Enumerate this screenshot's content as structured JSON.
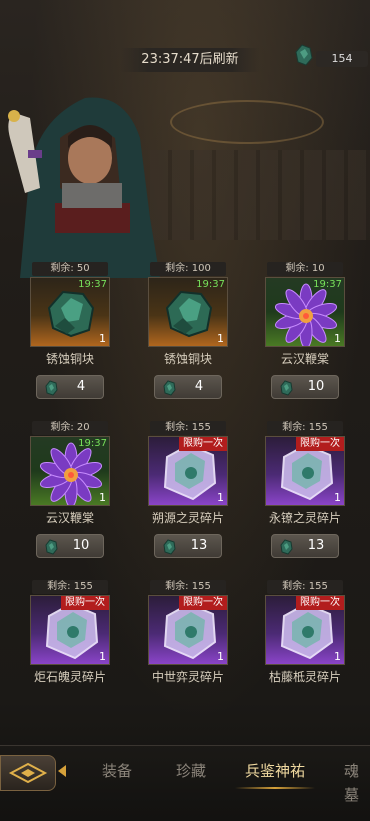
{
  "header": {
    "refresh_timer": "23:37:47后刷新",
    "currency_amount": "154",
    "currency_icon": "bronze-ore-icon"
  },
  "items": [
    {
      "stock": "剩余: 50",
      "timer": "19:37",
      "qty": "1",
      "limit": "",
      "name": "锈蚀铜块",
      "price": "4",
      "art": "bronze-ore-icon",
      "rarity": "orange"
    },
    {
      "stock": "剩余: 100",
      "timer": "19:37",
      "qty": "1",
      "limit": "",
      "name": "锈蚀铜块",
      "price": "4",
      "art": "bronze-ore-icon",
      "rarity": "orange"
    },
    {
      "stock": "剩余: 10",
      "timer": "19:37",
      "qty": "1",
      "limit": "",
      "name": "云汉鞭棠",
      "price": "10",
      "art": "purple-flower-icon",
      "rarity": "green"
    },
    {
      "stock": "剩余: 20",
      "timer": "19:37",
      "qty": "1",
      "limit": "",
      "name": "云汉鞭棠",
      "price": "10",
      "art": "purple-flower-icon",
      "rarity": "green"
    },
    {
      "stock": "剩余: 155",
      "timer": "",
      "qty": "1",
      "limit": "限购一次",
      "name": "朔源之灵碎片",
      "price": "13",
      "art": "spirit-crystal-icon",
      "rarity": "purple"
    },
    {
      "stock": "剩余: 155",
      "timer": "",
      "qty": "1",
      "limit": "限购一次",
      "name": "永镣之灵碎片",
      "price": "13",
      "art": "spirit-crystal-icon",
      "rarity": "purple"
    },
    {
      "stock": "剩余: 155",
      "timer": "",
      "qty": "1",
      "limit": "限购一次",
      "name": "炬石魄灵碎片",
      "price": "",
      "art": "spirit-crystal-icon",
      "rarity": "purple"
    },
    {
      "stock": "剩余: 155",
      "timer": "",
      "qty": "1",
      "limit": "限购一次",
      "name": "中世弈灵碎片",
      "price": "",
      "art": "spirit-crystal-icon",
      "rarity": "purple"
    },
    {
      "stock": "剩余: 155",
      "timer": "",
      "qty": "1",
      "limit": "限购一次",
      "name": "枯藤柢灵碎片",
      "price": "",
      "art": "spirit-crystal-icon",
      "rarity": "purple"
    }
  ],
  "nav": {
    "tabs": [
      "装备",
      "珍藏",
      "兵鉴神祐",
      "魂墓"
    ],
    "active_tab": "兵鉴神祐",
    "back_icon": "diamond-arrow-icon"
  },
  "colors": {
    "timer_green": "#77e05a",
    "limit_red": "#b21d1d",
    "accent_gold": "#d6a13a"
  }
}
